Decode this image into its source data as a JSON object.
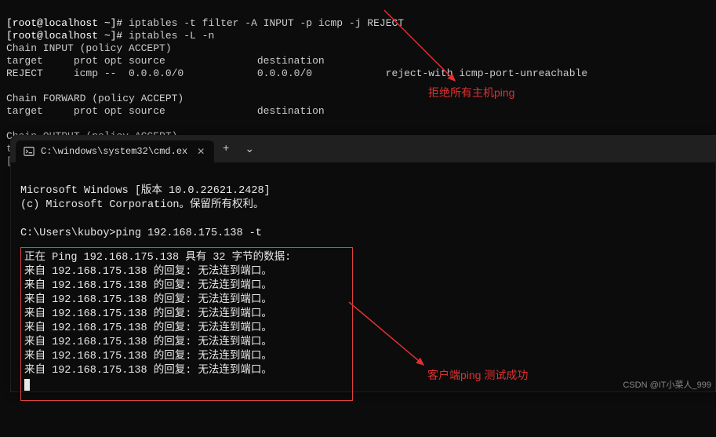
{
  "bg_terminal": {
    "prompt": "[root@localhost ~]#",
    "cmd1": "iptables -t filter -A INPUT -p icmp -j REJECT",
    "cmd2": "iptables -L -n",
    "chain_input": "Chain INPUT (policy ACCEPT)",
    "header": "target     prot opt source               destination",
    "rule": "REJECT     icmp --  0.0.0.0/0            0.0.0.0/0            reject-with icmp-port-unreachable",
    "chain_forward": "Chain FORWARD (policy ACCEPT)",
    "header2": "target     prot opt source               destination",
    "chain_output": "Chain OUTPUT (policy ACCEPT)",
    "cut1": "ta",
    "cut2": "["
  },
  "annotations": {
    "a1": "拒绝所有主机ping",
    "a2": "客户端ping 测试成功"
  },
  "cmd": {
    "tab_title": "C:\\windows\\system32\\cmd.ex",
    "plus": "+",
    "chevron": "⌄",
    "line1": "Microsoft Windows [版本 10.0.22621.2428]",
    "line2": "(c) Microsoft Corporation。保留所有权利。",
    "prompt": "C:\\Users\\kuboy>",
    "command": "ping 192.168.175.138 -t",
    "ping_header": "正在 Ping 192.168.175.138 具有 32 字节的数据:",
    "reply": "来自 192.168.175.138 的回复: 无法连到端口。",
    "reply_count": 8
  },
  "watermark": "CSDN @IT小菜人_999"
}
